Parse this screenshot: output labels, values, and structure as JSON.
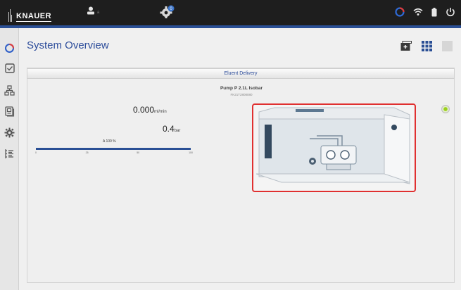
{
  "app": {
    "brand": "KNAUER",
    "user_sub": "a",
    "badge_count": "0"
  },
  "colors": {
    "accent": "#2a4f95",
    "topbar": "#1e1e1e",
    "highlight": "#e03030",
    "led": "#9bd01c"
  },
  "sidebar": {
    "items": [
      {
        "icon": "ring-icon",
        "active": true
      },
      {
        "icon": "checkbox-icon"
      },
      {
        "icon": "network-icon"
      },
      {
        "icon": "log-icon"
      },
      {
        "icon": "gear-icon"
      },
      {
        "icon": "list-icon"
      }
    ]
  },
  "header": {
    "title": "System Overview"
  },
  "panel": {
    "title": "Eluent Delivery",
    "pump_name": "Pump P 2.1L Isobar",
    "pump_serial": "FK21T2808080",
    "flow_value": "0.000",
    "flow_unit": "ml/min",
    "pressure_value": "0.4",
    "pressure_unit": "bar",
    "solvent_label": "A 100 %",
    "solvent_fraction": 1.0,
    "ticks": [
      "0",
      "25",
      "50",
      "100"
    ]
  }
}
